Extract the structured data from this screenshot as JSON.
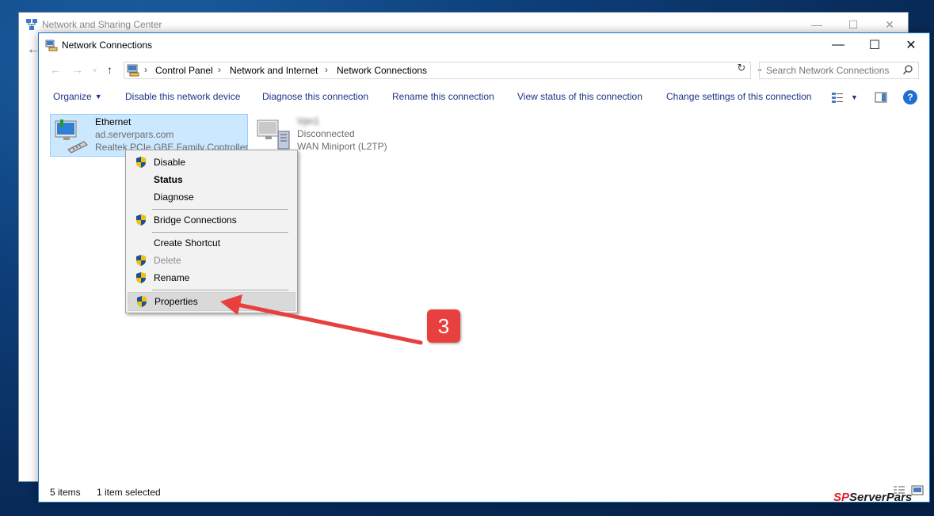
{
  "background_window": {
    "title": "Network and Sharing Center",
    "controls": [
      "—",
      "☐",
      "✕"
    ]
  },
  "window": {
    "title": "Network Connections",
    "controls": [
      "—",
      "☐",
      "✕"
    ]
  },
  "address": {
    "crumbs": [
      "Control Panel",
      "Network and Internet",
      "Network Connections"
    ],
    "search_placeholder": "Search Network Connections"
  },
  "toolbar": {
    "organize": "Organize",
    "disable": "Disable this network device",
    "diagnose": "Diagnose this connection",
    "rename": "Rename this connection",
    "view_status": "View status of this connection",
    "change_settings": "Change settings of this connection",
    "help": "?"
  },
  "connections": [
    {
      "name": "Ethernet",
      "status": "ad.serverpars.com",
      "device": "Realtek PCIe GBE Family Controller",
      "selected": true
    },
    {
      "name": "Vpn1",
      "status": "Disconnected",
      "device": "WAN Miniport (L2TP)",
      "selected": false
    }
  ],
  "context_menu": {
    "items": [
      {
        "label": "Disable",
        "shield": true
      },
      {
        "label": "Status",
        "bold": true
      },
      {
        "label": "Diagnose"
      },
      {
        "label": "Bridge Connections",
        "shield": true
      },
      {
        "label": "Create Shortcut"
      },
      {
        "label": "Delete",
        "shield": true,
        "disabled": true
      },
      {
        "label": "Rename",
        "shield": true
      },
      {
        "label": "Properties",
        "shield": true,
        "highlighted": true
      }
    ]
  },
  "annotation": {
    "step": "3",
    "color": "#e8403e"
  },
  "statusbar": {
    "count": "5 items",
    "selected": "1 item selected"
  },
  "watermark": {
    "part1": "SP",
    "part2": "ServerPars"
  },
  "colors": {
    "accent": "#1b78c8",
    "link": "#1e3287",
    "selection": "#cce8ff"
  }
}
